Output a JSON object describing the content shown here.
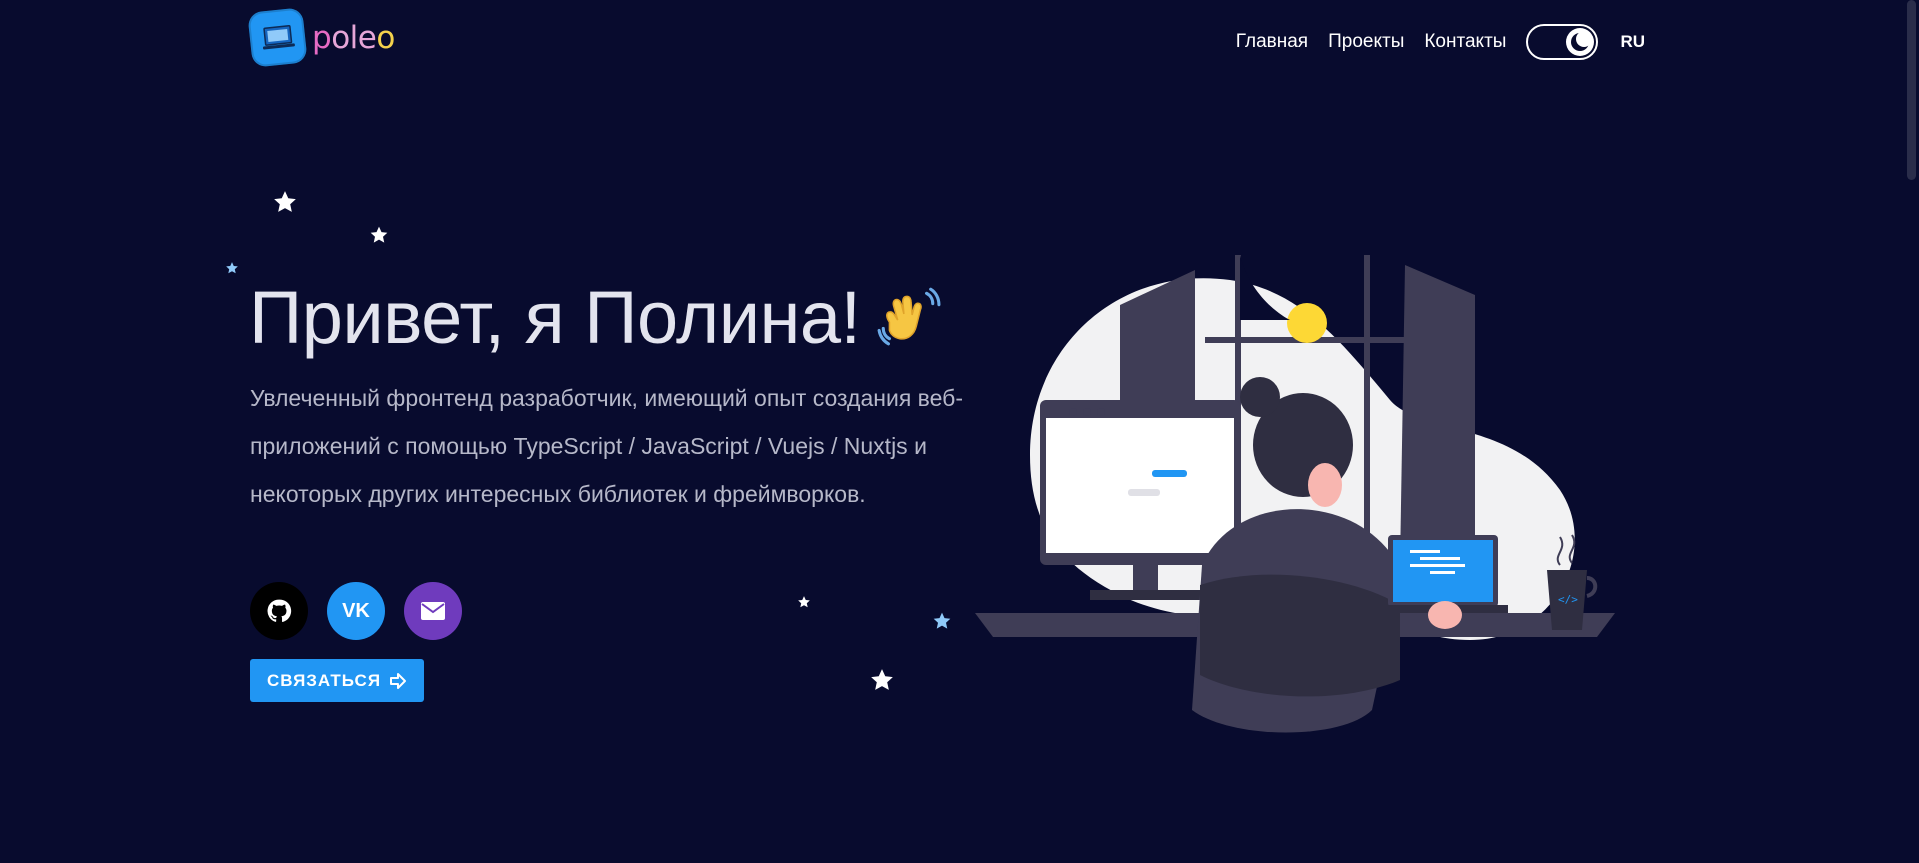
{
  "brand": {
    "logo_parts": [
      "p",
      "ole",
      "o"
    ],
    "colors": {
      "accent": "#2196f3",
      "background": "#080b2e",
      "mail": "#6f3bbd"
    }
  },
  "nav": {
    "items": [
      "Главная",
      "Проекты",
      "Контакты"
    ],
    "theme_toggle_icon": "moon-icon",
    "language": "RU"
  },
  "hero": {
    "title": "Привет, я Полина!",
    "description": "Увлеченный фронтенд разработчик, имеющий опыт создания веб-приложений с помощью TypeScript / JavaScript / Vuejs / Nuxtjs и некоторых других интересных библиотек и фреймворков.",
    "socials": [
      {
        "icon": "github-icon"
      },
      {
        "label": "VK"
      },
      {
        "icon": "mail-icon"
      }
    ],
    "cta_label": "СВЯЗАТЬСЯ"
  }
}
